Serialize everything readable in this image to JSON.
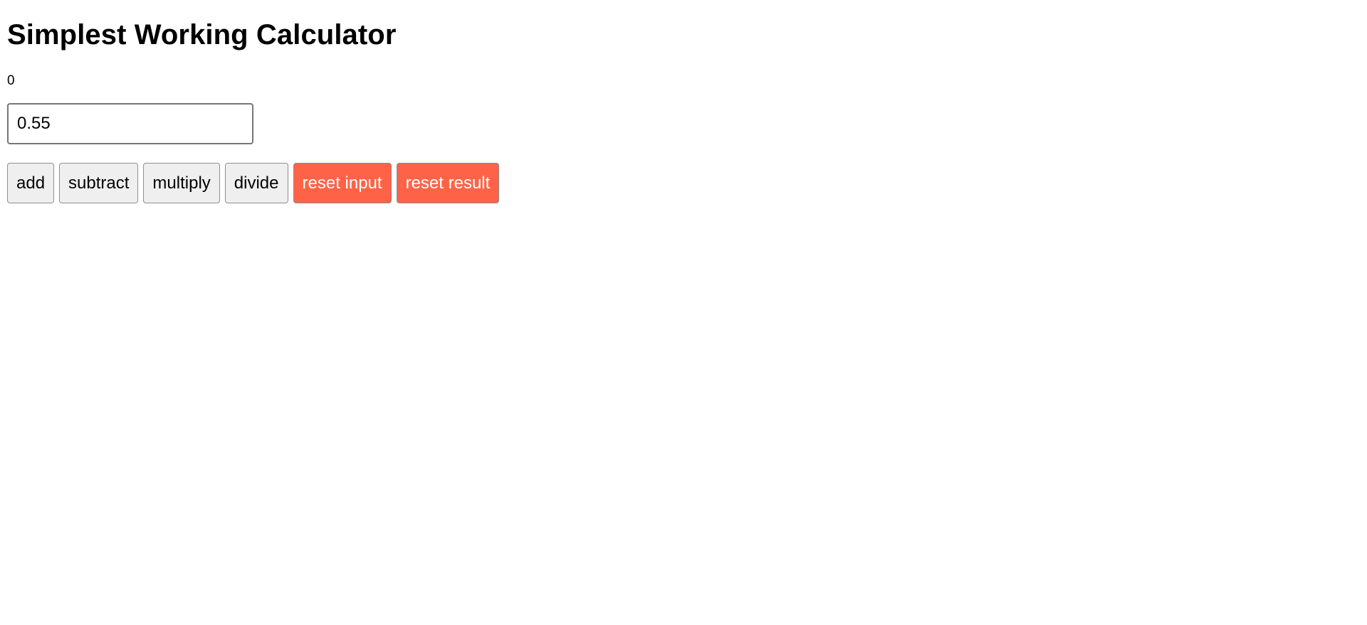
{
  "header": {
    "title": "Simplest Working Calculator"
  },
  "result": {
    "value": "0"
  },
  "input": {
    "value": "0.55"
  },
  "buttons": {
    "add": "add",
    "subtract": "subtract",
    "multiply": "multiply",
    "divide": "divide",
    "reset_input": "reset input",
    "reset_result": "reset result"
  },
  "colors": {
    "reset_button_bg": "#ff6347",
    "default_button_bg": "#efefef"
  }
}
